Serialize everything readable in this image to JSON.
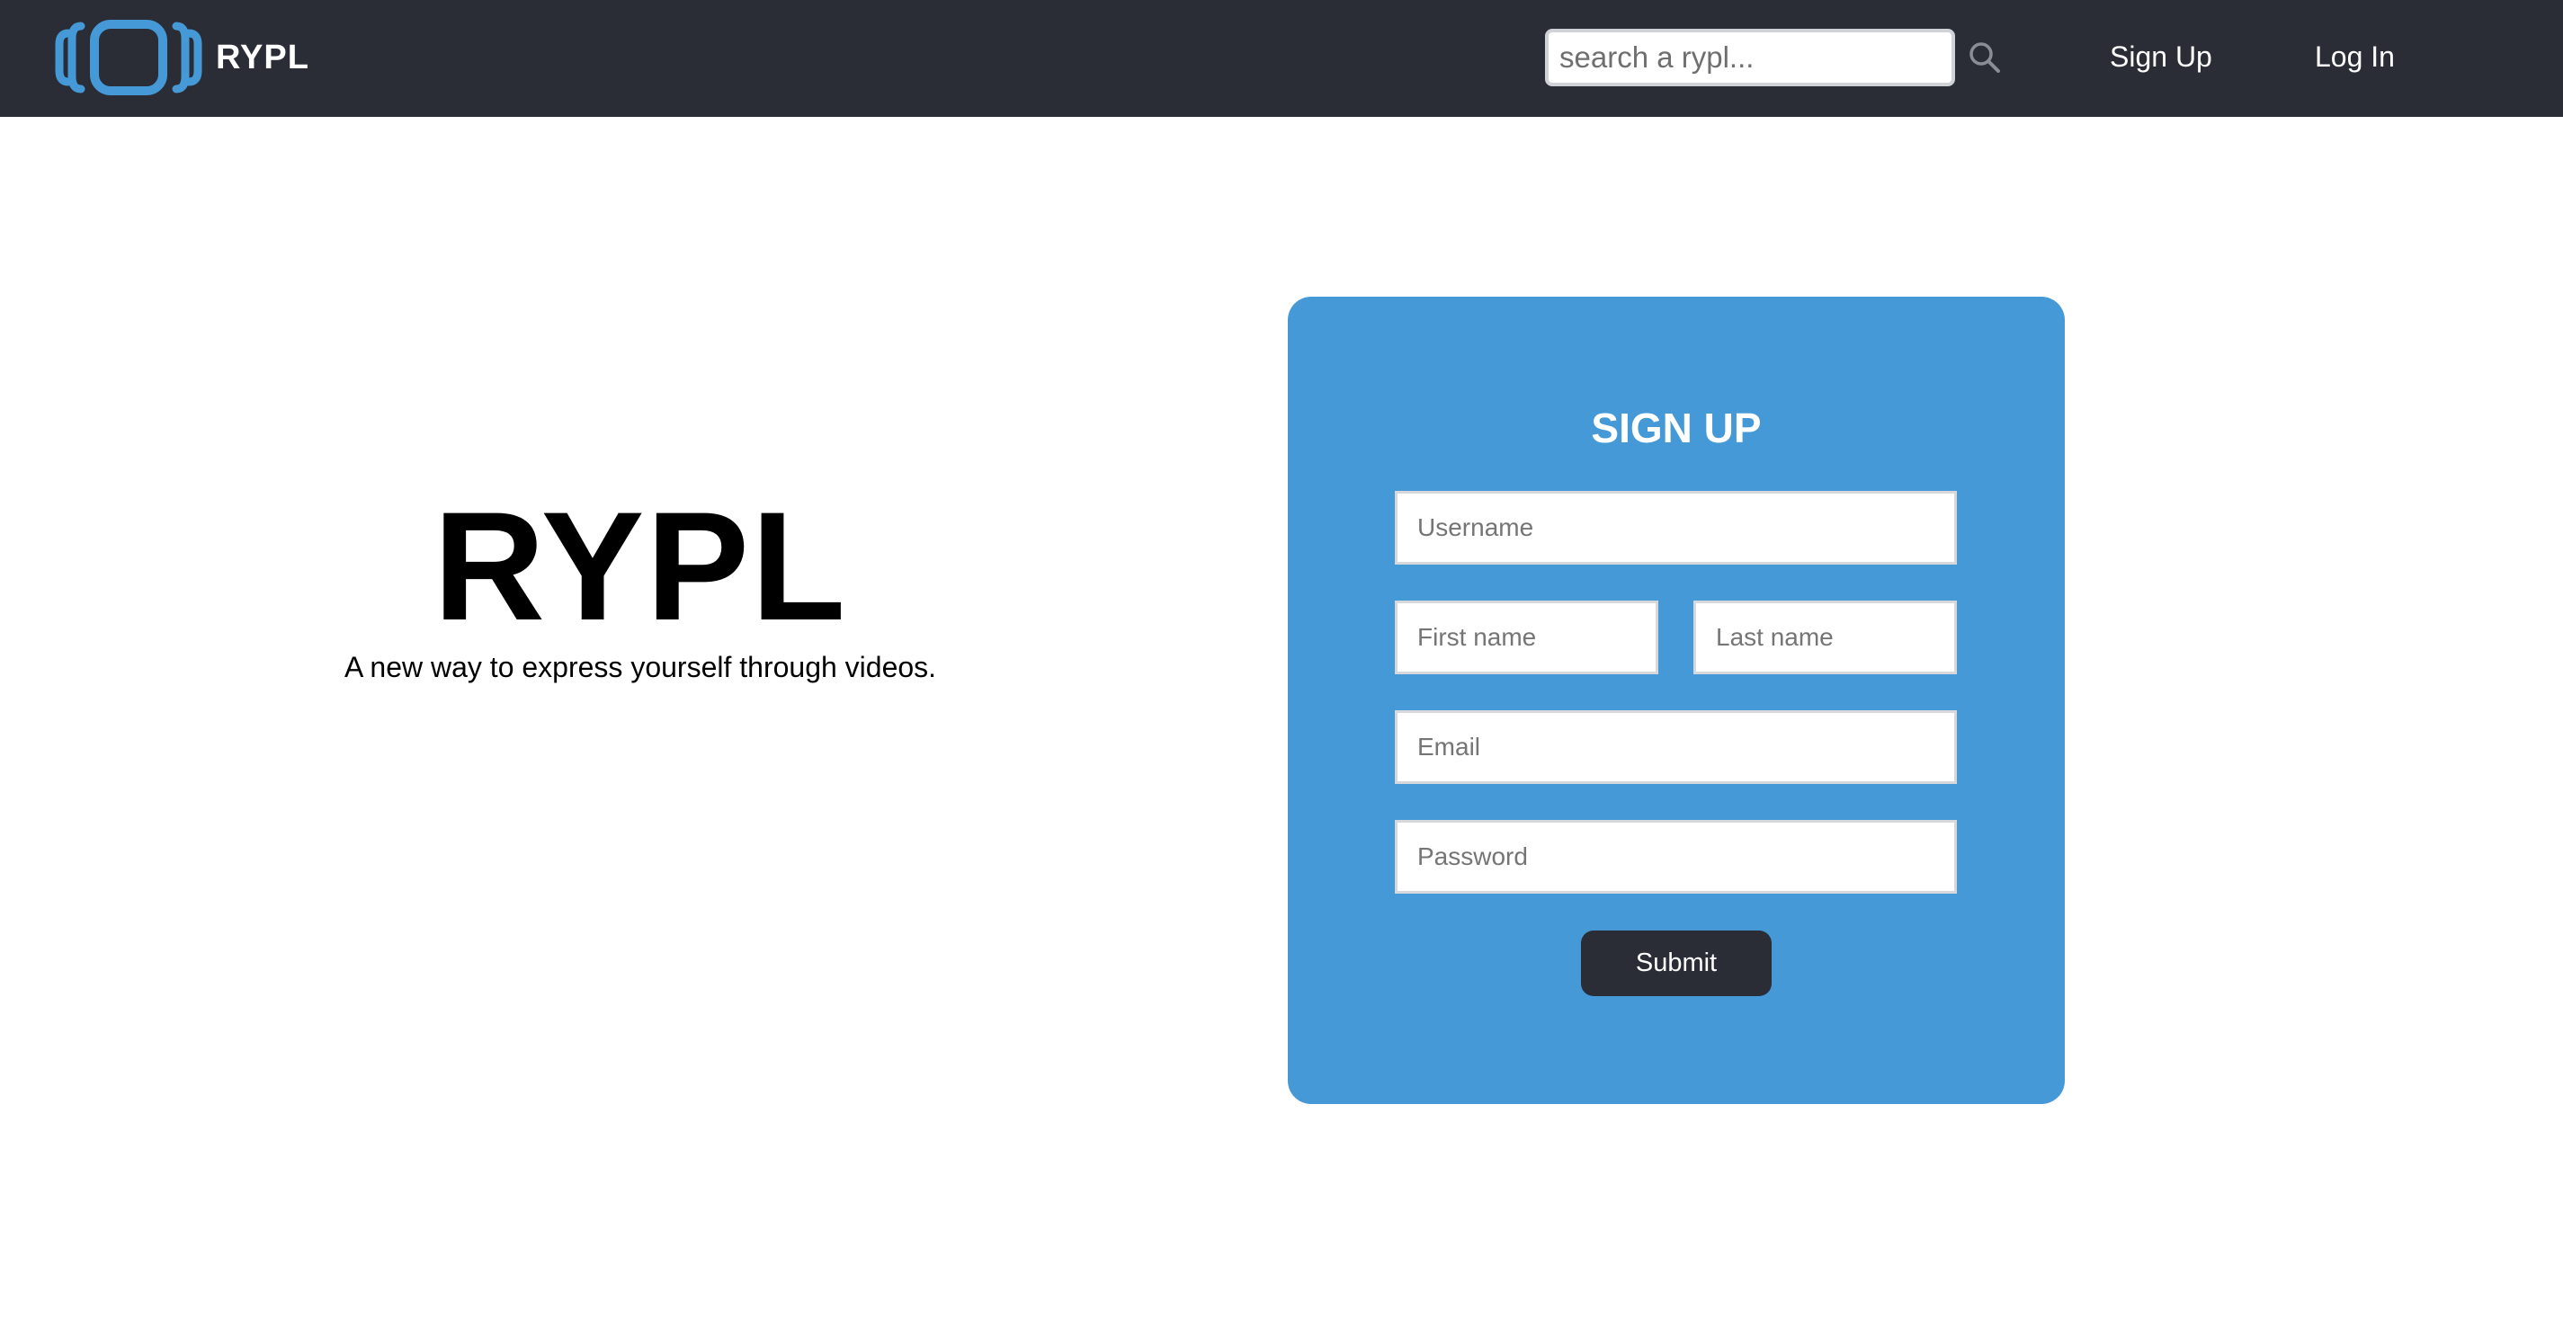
{
  "nav": {
    "brand_name": "RYPL",
    "search": {
      "placeholder": "search a rypl...",
      "value": ""
    },
    "links": [
      {
        "label": "Sign Up"
      },
      {
        "label": "Log In"
      }
    ]
  },
  "hero": {
    "title": "RYPL",
    "tagline": "A new way to express yourself through videos."
  },
  "signup_form": {
    "title": "SIGN UP",
    "username": {
      "placeholder": "Username",
      "value": ""
    },
    "first_name": {
      "placeholder": "First name",
      "value": ""
    },
    "last_name": {
      "placeholder": "Last name",
      "value": ""
    },
    "email": {
      "placeholder": "Email",
      "value": ""
    },
    "password": {
      "placeholder": "Password",
      "value": ""
    },
    "submit_label": "Submit"
  },
  "icons": {
    "logo": "rypl-logo-icon",
    "search": "search-icon"
  },
  "colors": {
    "navbar_bg": "#2a2d35",
    "accent_blue": "#4599d6",
    "button_dark": "#2a2d35",
    "text_white": "#ffffff"
  }
}
